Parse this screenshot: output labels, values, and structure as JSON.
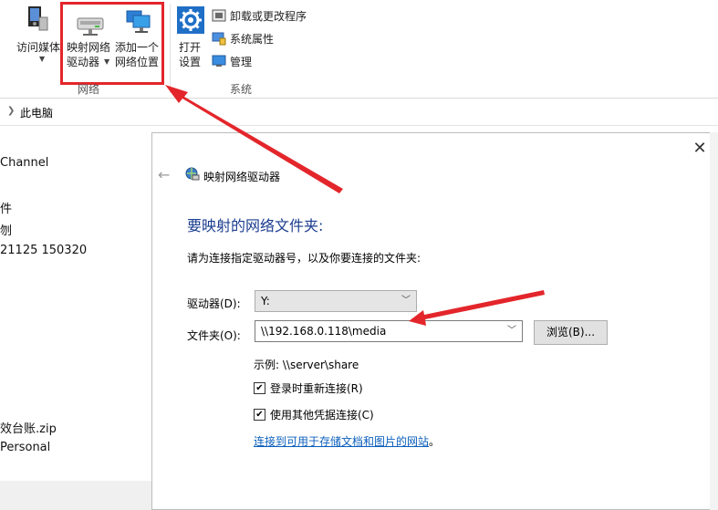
{
  "ribbon": {
    "access_media": "访问媒体",
    "map_drive_line1": "映射网络",
    "map_drive_line2": "驱动器",
    "add_location_line1": "添加一个",
    "add_location_line2": "网络位置",
    "open_settings_line1": "打开",
    "open_settings_line2": "设置",
    "uninstall": "卸载或更改程序",
    "system_properties": "系统属性",
    "manage": "管理",
    "group_network": "网络",
    "group_system": "系统"
  },
  "address": {
    "crumb": "此电脑"
  },
  "background_items": [
    "Channel",
    "件",
    "刎",
    "21125 150320",
    "效台账.zip",
    "Personal"
  ],
  "dialog": {
    "title": "映射网络驱动器",
    "heading": "要映射的网络文件夹:",
    "instruction": "请为连接指定驱动器号，以及你要连接的文件夹:",
    "drive_label": "驱动器(D):",
    "drive_value": "Y:",
    "folder_label": "文件夹(O):",
    "folder_value": "\\\\192.168.0.118\\media",
    "browse": "浏览(B)...",
    "example": "示例: \\\\server\\share",
    "reconnect": "登录时重新连接(R)",
    "other_credentials": "使用其他凭据连接(C)",
    "link": "连接到可用于存储文档和图片的网站",
    "link_suffix": "。"
  },
  "colors": {
    "highlight": "#e3262b",
    "heading": "#1a3c8f",
    "link": "#0b5fbd",
    "gear": "#1f6fc7"
  }
}
